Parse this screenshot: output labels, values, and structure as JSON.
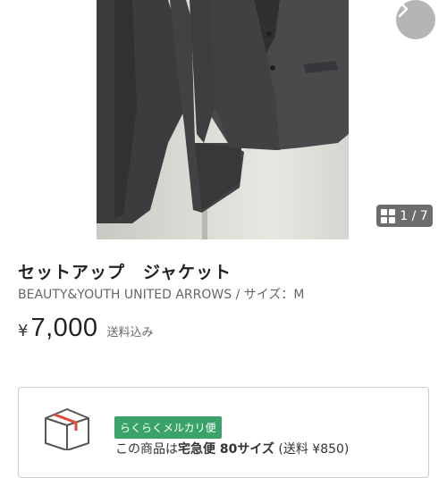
{
  "gallery": {
    "current": 1,
    "total": 7,
    "counter_text": "1 / 7",
    "next_icon": "chevron-right-icon",
    "grid_icon": "grid-icon"
  },
  "product": {
    "title": "セットアップ　ジャケット",
    "brand_size": "BEAUTY&YOUTH UNITED ARROWS / サイズ：M",
    "currency_symbol": "¥",
    "price": "7,000",
    "shipping_included": "送料込み"
  },
  "shipping": {
    "method_badge": "らくらくメルカリ便",
    "note_prefix": "この商品は",
    "note_bold": "宅急便 80サイズ",
    "note_suffix": " (送料 ¥850)",
    "icon": "box-icon",
    "badge_color": "#3aa36a",
    "icon_accent": "#e0473b"
  }
}
